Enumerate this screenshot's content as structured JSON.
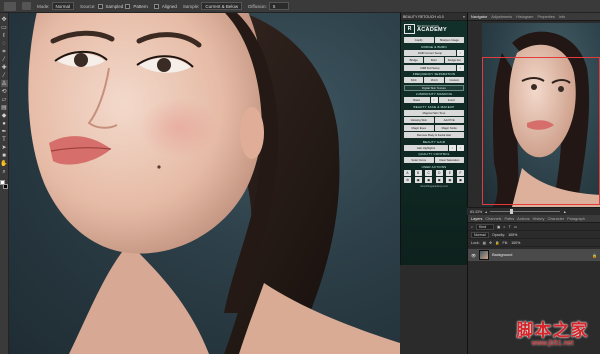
{
  "options_bar": {
    "mode_label": "Mode:",
    "mode_value": "Normal",
    "source_label": "Source:",
    "source_sampled": "Sampled",
    "source_pattern": "Pattern",
    "aligned_label": "Aligned",
    "sample_label": "Sample:",
    "sample_value": "Current & Below",
    "diffusion_label": "Diffusion:",
    "diffusion_value": "5"
  },
  "toolbar": {
    "tools": [
      "move-tool",
      "marquee-tool",
      "lasso-tool",
      "quick-select-tool",
      "crop-tool",
      "eyedropper-tool",
      "healing-tool",
      "brush-tool",
      "clone-stamp-tool",
      "history-brush-tool",
      "eraser-tool",
      "gradient-tool",
      "blur-tool",
      "dodge-tool",
      "pen-tool",
      "type-tool",
      "path-select-tool",
      "shape-tool",
      "hand-tool",
      "zoom-tool"
    ],
    "foreground_color": "#ffffff",
    "background_color": "#000000"
  },
  "retouch_panel": {
    "header_title": "BEAUTY RETOUCH v3.0",
    "logo_small": "RETOUCHING",
    "logo_big": "ACADEMY",
    "buttons_top": [
      "Copify",
      "Sharpen Image"
    ],
    "section_dodge_burn": "DODGE & BURN",
    "db_current_setup": "D&B Current Setup",
    "db_row": [
      "Bridge",
      "Burn",
      "Dodge Aut"
    ],
    "db_full": "D&B Full Setup",
    "section_frequency": "FREQUENCY SEPARATION",
    "freq_row": [
      "8-bit",
      "16-bit",
      "Custom"
    ],
    "digital_skin": "Digital Skin Texture",
    "section_luminosity": "LUMINOSITY MASKING",
    "lum_row": [
      "Basic",
      "Invert"
    ],
    "section_beauty": "BEAUTY FACE & MAKEUP",
    "magical_skin": "Magical Skin Tone",
    "beauty_row1": [
      "Glowing Skin",
      "Add Pink"
    ],
    "beauty_row2": [
      "Magic Eyes",
      "Magic Smile"
    ],
    "remove_body": "Remove Body & Facial Hair",
    "section_hair": "BEAUTY HAIR",
    "hair_highlights": "Hair Highlights",
    "section_quality": "QUALITY CONTROL",
    "quality_row": [
      "Solar Curve",
      "Clear Saturation"
    ],
    "section_user": "USER ACTIONS",
    "user_row1": [
      "A",
      "B",
      "C",
      "D",
      "E",
      "F"
    ],
    "user_row2": [
      "⚙",
      "▣",
      "▣",
      "▣",
      "▣",
      "▣"
    ],
    "url": "retouchingacademy.com"
  },
  "navigator_panel": {
    "tabs": [
      "Navigator",
      "Adjustments",
      "Histogram",
      "Properties",
      "Info"
    ],
    "zoom_value": "83.33%"
  },
  "layers_panel": {
    "tabs": [
      "Layers",
      "Channels",
      "Paths",
      "Actions",
      "History",
      "Character",
      "Paragraph"
    ],
    "filter_label": "Kind",
    "blend_mode": "Normal",
    "opacity_label": "Opacity:",
    "opacity_value": "100%",
    "lock_label": "Lock:",
    "fill_label": "Fill:",
    "fill_value": "100%",
    "layer_name": "Background"
  },
  "watermark": {
    "cn_text": "脚本之家",
    "url": "www.jb51.net"
  }
}
